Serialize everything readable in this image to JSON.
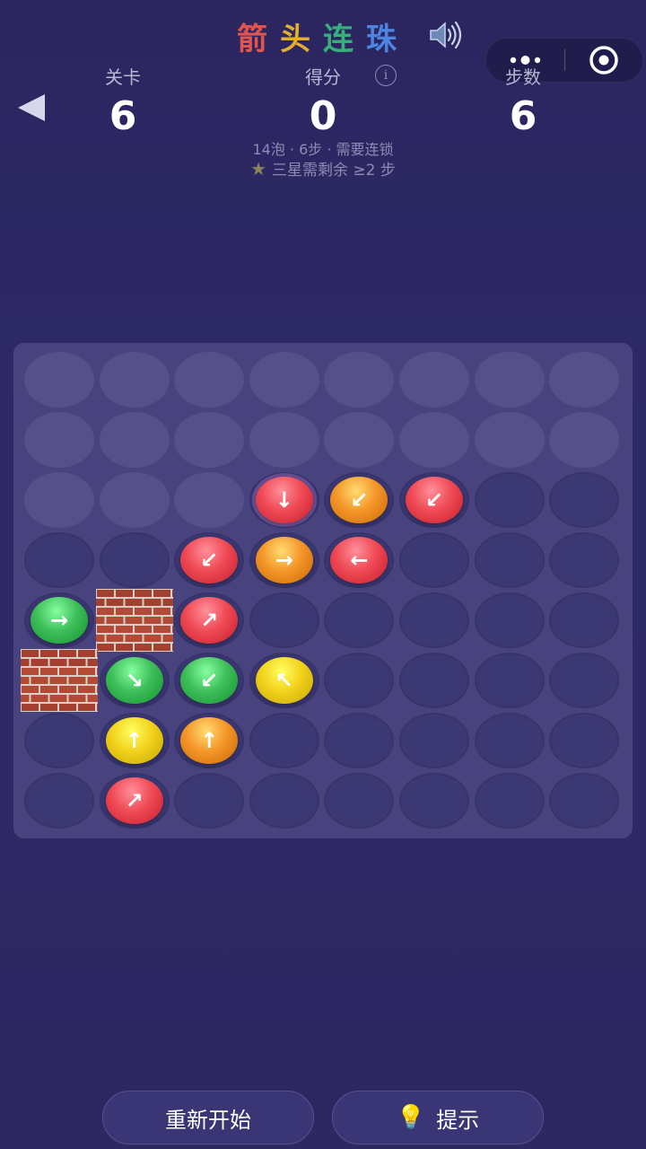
{
  "header": {
    "title_chars": [
      {
        "ch": "箭",
        "color": "#e0564f"
      },
      {
        "ch": "头",
        "color": "#e3ad2e"
      },
      {
        "ch": "连",
        "color": "#36b07a"
      },
      {
        "ch": "珠",
        "color": "#4c84e0"
      }
    ],
    "icons": {
      "sound": "speaker-icon",
      "back": "back-arrow-icon",
      "more": "more-dots-icon",
      "record": "record-icon",
      "info": "info-icon"
    }
  },
  "stats": {
    "level_label": "关卡",
    "level_value": "6",
    "score_label": "得分",
    "score_value": "0",
    "steps_label": "步数",
    "steps_value": "6"
  },
  "info_glyph": "i",
  "subinfo": {
    "line1": "14泡 · 6步 · 需要连锁",
    "line2": "三星需剩余 ≥2 步"
  },
  "board": {
    "rows": 8,
    "cols": 8,
    "colors": {
      "red": "#ef4a55",
      "orange": "#f4962a",
      "green": "#3fbf5a",
      "yellow": "#f2d21c"
    },
    "light_cells": [
      [
        0,
        0
      ],
      [
        0,
        1
      ],
      [
        0,
        2
      ],
      [
        0,
        3
      ],
      [
        0,
        4
      ],
      [
        0,
        5
      ],
      [
        0,
        6
      ],
      [
        0,
        7
      ],
      [
        1,
        0
      ],
      [
        1,
        1
      ],
      [
        1,
        2
      ],
      [
        1,
        3
      ],
      [
        1,
        4
      ],
      [
        1,
        5
      ],
      [
        1,
        6
      ],
      [
        1,
        7
      ],
      [
        2,
        0
      ],
      [
        2,
        1
      ],
      [
        2,
        2
      ]
    ],
    "bricks": [
      [
        4,
        1
      ],
      [
        5,
        0
      ]
    ],
    "balls": [
      {
        "row": 2,
        "col": 3,
        "color": "red",
        "arrow": "↓",
        "selected": true
      },
      {
        "row": 2,
        "col": 4,
        "color": "orange",
        "arrow": "↙"
      },
      {
        "row": 2,
        "col": 5,
        "color": "red",
        "arrow": "↙"
      },
      {
        "row": 3,
        "col": 2,
        "color": "red",
        "arrow": "↙"
      },
      {
        "row": 3,
        "col": 3,
        "color": "orange",
        "arrow": "→"
      },
      {
        "row": 3,
        "col": 4,
        "color": "red",
        "arrow": "←"
      },
      {
        "row": 4,
        "col": 0,
        "color": "green",
        "arrow": "→"
      },
      {
        "row": 4,
        "col": 2,
        "color": "red",
        "arrow": "↗"
      },
      {
        "row": 5,
        "col": 1,
        "color": "green",
        "arrow": "↘"
      },
      {
        "row": 5,
        "col": 2,
        "color": "green",
        "arrow": "↙"
      },
      {
        "row": 5,
        "col": 3,
        "color": "yellow",
        "arrow": "↖"
      },
      {
        "row": 6,
        "col": 1,
        "color": "yellow",
        "arrow": "↑"
      },
      {
        "row": 6,
        "col": 2,
        "color": "orange",
        "arrow": "↑"
      },
      {
        "row": 7,
        "col": 1,
        "color": "red",
        "arrow": "↗"
      }
    ]
  },
  "buttons": {
    "restart_label": "重新开始",
    "hint_label": "提示",
    "hint_icon": "lightbulb-icon"
  }
}
